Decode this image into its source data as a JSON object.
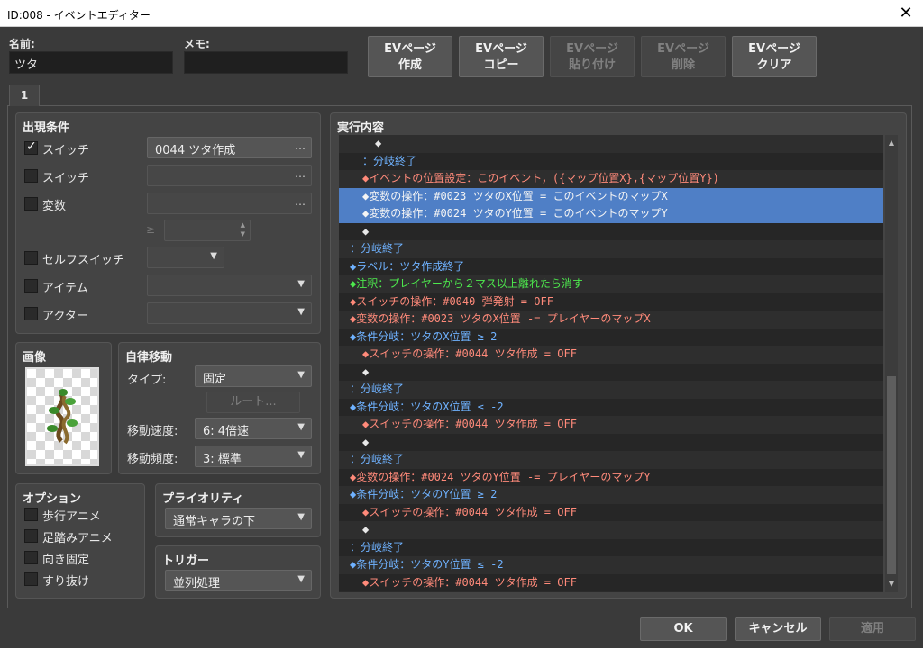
{
  "window": {
    "title": "ID:008 - イベントエディター",
    "close_glyph": "✕"
  },
  "name": {
    "label": "名前:",
    "value": "ツタ"
  },
  "memo": {
    "label": "メモ:",
    "value": ""
  },
  "ev_buttons": [
    {
      "line1": "EVページ",
      "line2": "作成",
      "enabled": true
    },
    {
      "line1": "EVページ",
      "line2": "コピー",
      "enabled": true
    },
    {
      "line1": "EVページ",
      "line2": "貼り付け",
      "enabled": false
    },
    {
      "line1": "EVページ",
      "line2": "削除",
      "enabled": false
    },
    {
      "line1": "EVページ",
      "line2": "クリア",
      "enabled": true
    }
  ],
  "tab": {
    "label": "1"
  },
  "conditions": {
    "title": "出現条件",
    "switch1": {
      "label": "スイッチ",
      "checked": true,
      "value": "0044 ツタ作成",
      "dots": "…"
    },
    "switch2": {
      "label": "スイッチ",
      "checked": false,
      "value": "",
      "dots": "…"
    },
    "variable": {
      "label": "変数",
      "checked": false,
      "value": "",
      "dots": "…",
      "op": "≥",
      "num": ""
    },
    "self_switch": {
      "label": "セルフスイッチ",
      "checked": false,
      "value": ""
    },
    "item": {
      "label": "アイテム",
      "checked": false,
      "value": ""
    },
    "actor": {
      "label": "アクター",
      "checked": false,
      "value": ""
    }
  },
  "image": {
    "title": "画像"
  },
  "autonomous": {
    "title": "自律移動",
    "type_label": "タイプ:",
    "type_value": "固定",
    "route_label": "ルート...",
    "speed_label": "移動速度:",
    "speed_value": "6: 4倍速",
    "freq_label": "移動頻度:",
    "freq_value": "3: 標準"
  },
  "options": {
    "title": "オプション",
    "items": [
      {
        "label": "歩行アニメ",
        "checked": false
      },
      {
        "label": "足踏みアニメ",
        "checked": false
      },
      {
        "label": "向き固定",
        "checked": false
      },
      {
        "label": "すり抜け",
        "checked": false
      }
    ]
  },
  "priority": {
    "title": "プライオリティ",
    "value": "通常キャラの下"
  },
  "trigger": {
    "title": "トリガー",
    "value": "並列処理"
  },
  "contents": {
    "title": "実行内容",
    "lines": [
      {
        "indent": 2,
        "text": "◆",
        "color": "white",
        "selected": false
      },
      {
        "indent": 1,
        "text": "：分岐終了",
        "color": "blue",
        "selected": false
      },
      {
        "indent": 1,
        "text": "◆イベントの位置設定：このイベント，({マップ位置X},{マップ位置Y})",
        "color": "red",
        "selected": false
      },
      {
        "indent": 1,
        "text": "◆変数の操作：#0023 ツタのX位置 = このイベントのマップX",
        "color": "red",
        "selected": true
      },
      {
        "indent": 1,
        "text": "◆変数の操作：#0024 ツタのY位置 = このイベントのマップY",
        "color": "red",
        "selected": true
      },
      {
        "indent": 1,
        "text": "◆",
        "color": "white",
        "selected": false
      },
      {
        "indent": 0,
        "text": "：分岐終了",
        "color": "blue",
        "selected": false
      },
      {
        "indent": 0,
        "text": "◆ラベル：ツタ作成終了",
        "color": "blue",
        "selected": false
      },
      {
        "indent": 0,
        "text": "◆注釈：プレイヤーから２マス以上離れたら消す",
        "color": "green",
        "selected": false
      },
      {
        "indent": 0,
        "text": "◆スイッチの操作：#0040 弾発射 = OFF",
        "color": "red",
        "selected": false
      },
      {
        "indent": 0,
        "text": "◆変数の操作：#0023 ツタのX位置 -= プレイヤーのマップX",
        "color": "red",
        "selected": false
      },
      {
        "indent": 0,
        "text": "◆条件分岐：ツタのX位置 ≥ 2",
        "color": "blue",
        "selected": false
      },
      {
        "indent": 1,
        "text": "◆スイッチの操作：#0044 ツタ作成 = OFF",
        "color": "red",
        "selected": false
      },
      {
        "indent": 1,
        "text": "◆",
        "color": "white",
        "selected": false
      },
      {
        "indent": 0,
        "text": "：分岐終了",
        "color": "blue",
        "selected": false
      },
      {
        "indent": 0,
        "text": "◆条件分岐：ツタのX位置 ≤ -2",
        "color": "blue",
        "selected": false
      },
      {
        "indent": 1,
        "text": "◆スイッチの操作：#0044 ツタ作成 = OFF",
        "color": "red",
        "selected": false
      },
      {
        "indent": 1,
        "text": "◆",
        "color": "white",
        "selected": false
      },
      {
        "indent": 0,
        "text": "：分岐終了",
        "color": "blue",
        "selected": false
      },
      {
        "indent": 0,
        "text": "◆変数の操作：#0024 ツタのY位置 -= プレイヤーのマップY",
        "color": "red",
        "selected": false
      },
      {
        "indent": 0,
        "text": "◆条件分岐：ツタのY位置 ≥ 2",
        "color": "blue",
        "selected": false
      },
      {
        "indent": 1,
        "text": "◆スイッチの操作：#0044 ツタ作成 = OFF",
        "color": "red",
        "selected": false
      },
      {
        "indent": 1,
        "text": "◆",
        "color": "white",
        "selected": false
      },
      {
        "indent": 0,
        "text": "：分岐終了",
        "color": "blue",
        "selected": false
      },
      {
        "indent": 0,
        "text": "◆条件分岐：ツタのY位置 ≤ -2",
        "color": "blue",
        "selected": false
      },
      {
        "indent": 1,
        "text": "◆スイッチの操作：#0044 ツタ作成 = OFF",
        "color": "red",
        "selected": false
      }
    ]
  },
  "footer": {
    "ok": "OK",
    "cancel": "キャンセル",
    "apply": "適用"
  },
  "colors": {
    "selection": "#4f7fc6",
    "blue_text": "#6fb2ff",
    "red_text": "#ff8a7a",
    "green_text": "#4dea4d"
  },
  "icons": {
    "check": "check-icon",
    "dropdown": "chevron-down-icon",
    "close": "close-icon"
  }
}
